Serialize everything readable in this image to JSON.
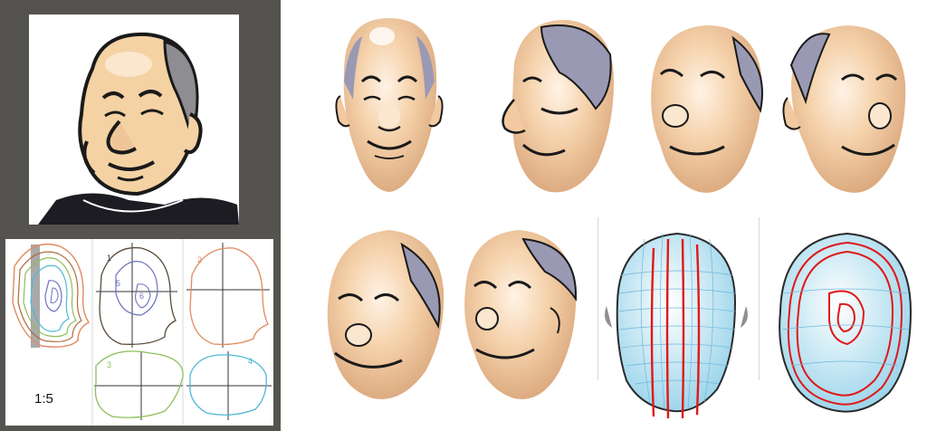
{
  "contour_sheet": {
    "scale_label": "1:5",
    "section_numbers": [
      "1",
      "2",
      "3",
      "4",
      "5",
      "6"
    ]
  },
  "colors": {
    "panel_background": "#55534f",
    "skin": "#f2cfa4",
    "skin_highlight": "#fbe7cf",
    "hair": "#9a99b4",
    "ink": "#1a1a1a",
    "contour_brown": "#b06a3a",
    "contour_orange": "#e08a60",
    "contour_green": "#8cbf5a",
    "contour_cyan": "#4fb8d8",
    "contour_purple": "#6f6fc0",
    "wire_blue": "#8fd0ee",
    "wire_red": "#e01818"
  },
  "renders": {
    "textured_views": [
      "front",
      "left-profile",
      "three-quarter-left",
      "three-quarter-right",
      "three-quarter-down",
      "three-quarter-right-low"
    ],
    "wireframe_views": [
      "wire-back",
      "wire-side"
    ]
  }
}
